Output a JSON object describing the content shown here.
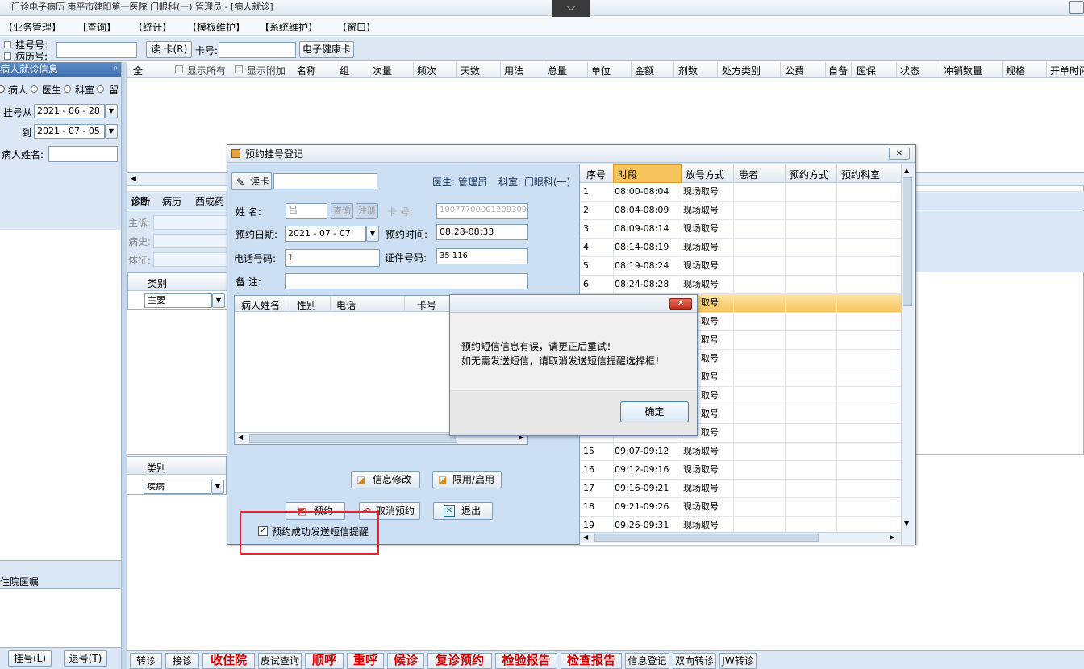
{
  "window": {
    "title": "门诊电子病历  南平市建阳第一医院  门眼科(一)  管理员 - [病人就诊]",
    "collapse_glyph": "⌵"
  },
  "menu": [
    "【业务管理】",
    "【查询】",
    "【统计】",
    "【模板维护】",
    "【系统维护】",
    "【窗口】"
  ],
  "toolbar": {
    "reg_no_label": "挂号号:",
    "record_no_label": "病历号:",
    "read_card": "读 卡(R)",
    "card_no_label": "卡号:",
    "ehealth_card": "电子健康卡"
  },
  "left": {
    "header": "病人就诊信息",
    "pin": "ᵖ",
    "radios": [
      "病人",
      "医生",
      "科室",
      "留"
    ],
    "reg_from_label": "挂号从",
    "reg_from": "2021 - 06 - 28",
    "reg_to_label": "到",
    "reg_to": "2021 - 07 - 05",
    "name_label": "病人姓名:",
    "orders_label": "住院医嘱",
    "btn_register": "挂号(L)",
    "btn_unregister": "退号(T)"
  },
  "grid": {
    "columns": [
      "全",
      "显示所有",
      "显示附加",
      "名称",
      "组",
      "次量",
      "频次",
      "天数",
      "用法",
      "总量",
      "单位",
      "金额",
      "剂数",
      "处方类别",
      "公费",
      "自备",
      "医保",
      "状态",
      "冲销数量",
      "规格",
      "开单时间"
    ]
  },
  "mid": {
    "tabs": [
      "诊断",
      "病历",
      "西成药"
    ],
    "fields": [
      "主诉:",
      "病史:",
      "体征:"
    ],
    "cat_header": "类别",
    "cat_value": "主要",
    "cat2_header": "类别",
    "cat2_value": "疾病"
  },
  "bottom": [
    {
      "label": "转诊",
      "red": false
    },
    {
      "label": "接诊",
      "red": false
    },
    {
      "label": "收住院",
      "red": true
    },
    {
      "label": "皮试查询",
      "red": false
    },
    {
      "label": "顺呼",
      "red": true
    },
    {
      "label": "重呼",
      "red": true
    },
    {
      "label": "候诊",
      "red": true
    },
    {
      "label": "复诊预约",
      "red": true
    },
    {
      "label": "检验报告",
      "red": true
    },
    {
      "label": "检查报告",
      "red": true
    },
    {
      "label": "信息登记",
      "red": false
    },
    {
      "label": "双向转诊",
      "red": false
    },
    {
      "label": "JW转诊",
      "red": false
    }
  ],
  "dialog": {
    "title": "预约挂号登记",
    "close": "✕",
    "read_card": "读卡",
    "doctor": "医生: 管理员",
    "dept": "科室: 门眼科(一)",
    "name_label": "姓    名:",
    "name_value": "吕",
    "query_btn": "查询",
    "register_btn": "注册",
    "card_label": "卡    号:",
    "card_value": "10077700001209309",
    "date_label": "预约日期:",
    "date_value": "2021 - 07 - 07",
    "time_label": "预约时间:",
    "time_value": "08:28-08:33",
    "phone_label": "电话号码:",
    "phone_value": "1",
    "id_label": "证件号码:",
    "id_value": "35              116",
    "note_label": "备    注:",
    "list_cols": [
      "病人姓名",
      "性别",
      "电话",
      "卡号"
    ],
    "btn_edit": "信息修改",
    "btn_limit": "限用/启用",
    "btn_book": "预约",
    "btn_cancel": "取消预约",
    "btn_exit": "退出",
    "sms_checkbox": "预约成功发送短信提醒",
    "sms_checked": true,
    "right_cols": [
      "序号",
      "时段",
      "放号方式",
      "患者",
      "预约方式",
      "预约科室"
    ],
    "rows": [
      [
        "1",
        "08:00-08:04",
        "现场取号"
      ],
      [
        "2",
        "08:04-08:09",
        "现场取号"
      ],
      [
        "3",
        "08:09-08:14",
        "现场取号"
      ],
      [
        "4",
        "08:14-08:19",
        "现场取号"
      ],
      [
        "5",
        "08:19-08:24",
        "现场取号"
      ],
      [
        "6",
        "08:24-08:28",
        "现场取号"
      ],
      [
        "",
        "",
        "取号"
      ],
      [
        "",
        "",
        "取号"
      ],
      [
        "",
        "",
        "取号"
      ],
      [
        "",
        "",
        "取号"
      ],
      [
        "",
        "",
        "取号"
      ],
      [
        "",
        "",
        "取号"
      ],
      [
        "",
        "",
        "取号"
      ],
      [
        "",
        "",
        "取号"
      ],
      [
        "15",
        "09:07-09:12",
        "现场取号"
      ],
      [
        "16",
        "09:12-09:16",
        "现场取号"
      ],
      [
        "17",
        "09:16-09:21",
        "现场取号"
      ],
      [
        "18",
        "09:21-09:26",
        "现场取号"
      ],
      [
        "19",
        "09:26-09:31",
        "现场取号"
      ]
    ]
  },
  "alert": {
    "close": "✕",
    "line1": "预约短信信息有误，请更正后重试！",
    "line2": "如无需发送短信，请取消发送短信提醒选择框！",
    "ok": "确定"
  }
}
